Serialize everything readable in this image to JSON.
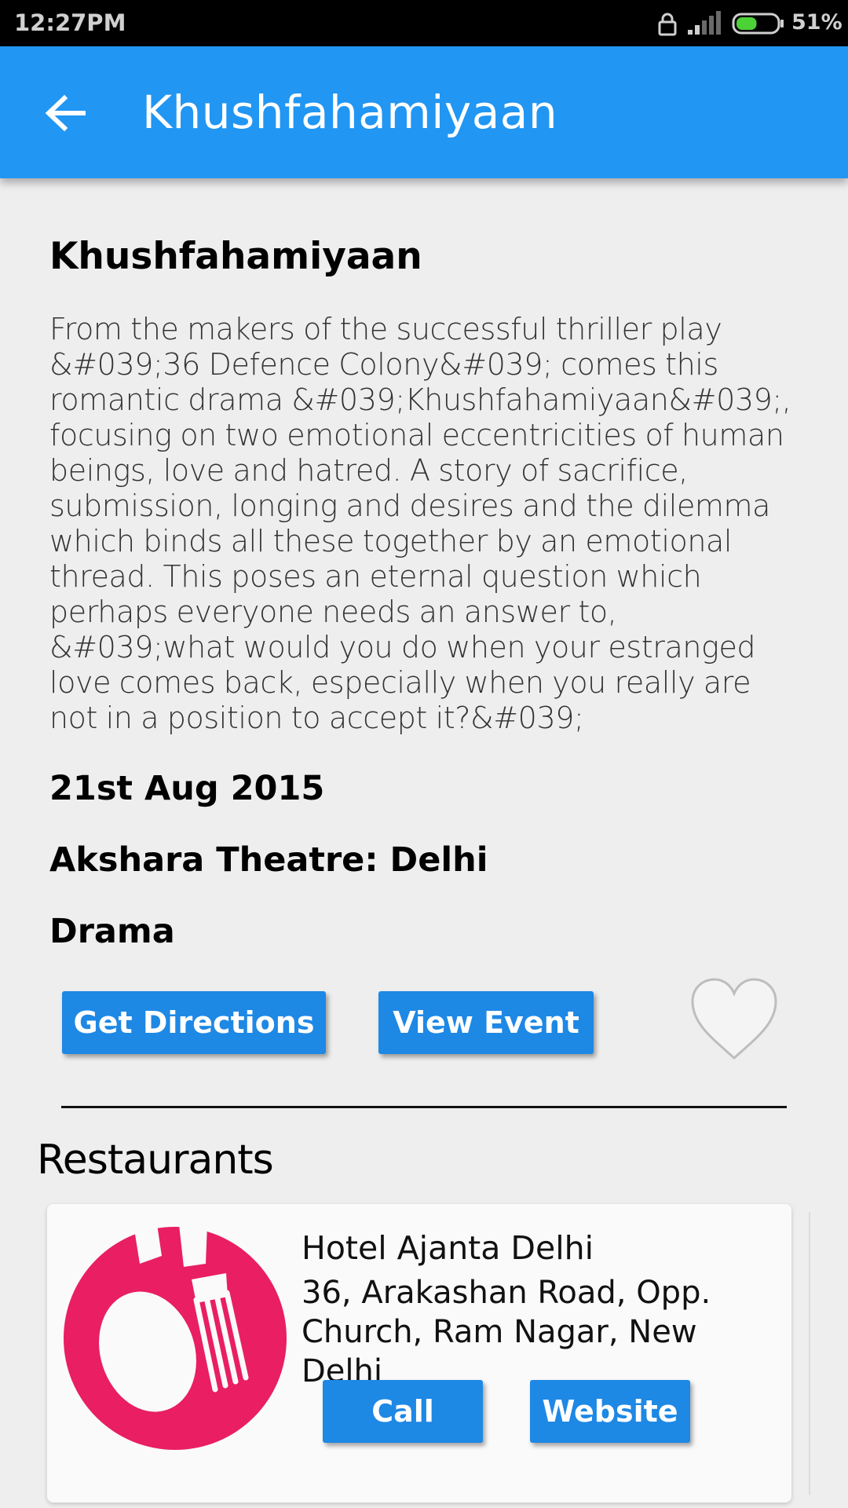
{
  "status_bar": {
    "time": "12:27PM",
    "battery_percent": "51%",
    "battery_level": 0.51,
    "icons": [
      "lock-icon",
      "signal-icon",
      "battery-icon"
    ]
  },
  "app_bar": {
    "title": "Khushfahamiyaan",
    "back_icon": "arrow-back-icon",
    "color": "#2196f3"
  },
  "event": {
    "title": "Khushfahamiyaan",
    "description": "From the makers of the successful thriller play &#039;36 Defence Colony&#039; comes this romantic drama &#039;Khushfahamiyaan&#039;, focusing on two emotional eccentricities of human beings, love and hatred.  A story of sacrifice, submission, longing and desires and the dilemma which binds all these together by an emotional thread. This poses an eternal question which perhaps everyone needs an answer to, &#039;what would you do when your estranged love comes back, especially when you really are not in a position to accept it?&#039;",
    "date": "21st Aug 2015",
    "venue": "Akshara Theatre: Delhi",
    "genre": "Drama",
    "buttons": {
      "directions": "Get Directions",
      "view_event": "View Event"
    },
    "favorite_icon": "heart-outline-icon"
  },
  "restaurants": {
    "section_title": "Restaurants",
    "items": [
      {
        "name": "Hotel Ajanta Delhi",
        "address": "36, Arakashan Road, Opp. Church, Ram Nagar, New Delhi",
        "logo_icon": "restaurant-logo-icon",
        "call_label": "Call",
        "website_label": "Website"
      }
    ]
  },
  "colors": {
    "accent": "#2196f3",
    "button": "#1e88e5",
    "logo": "#e91e63",
    "background": "#eeeeee"
  }
}
